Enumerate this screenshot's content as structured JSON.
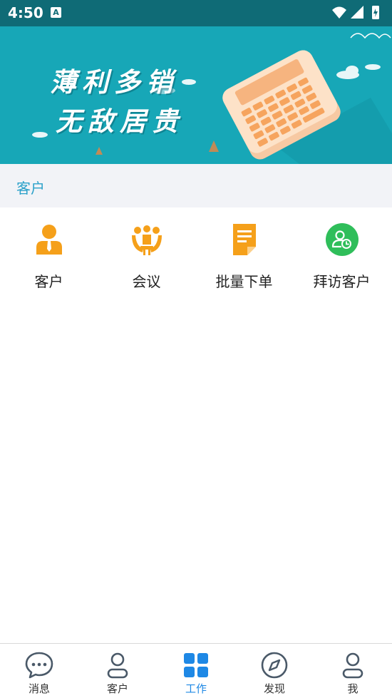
{
  "status_bar": {
    "time": "4:50",
    "notification_badge": "A"
  },
  "banner": {
    "line1": "薄利多销",
    "line2": "无敌居贵"
  },
  "section": {
    "title": "客户"
  },
  "grid": {
    "items": [
      {
        "label": "客户",
        "icon": "customer-icon"
      },
      {
        "label": "会议",
        "icon": "meeting-icon"
      },
      {
        "label": "批量下单",
        "icon": "batch-order-icon"
      },
      {
        "label": "拜访客户",
        "icon": "visit-customer-icon"
      }
    ]
  },
  "tabbar": {
    "items": [
      {
        "label": "消息",
        "icon": "message-icon"
      },
      {
        "label": "客户",
        "icon": "person-icon"
      },
      {
        "label": "工作",
        "icon": "grid-apps-icon",
        "active": true
      },
      {
        "label": "发现",
        "icon": "compass-icon"
      },
      {
        "label": "我",
        "icon": "profile-icon"
      }
    ]
  },
  "colors": {
    "status_bar": "#0f6b76",
    "banner": "#17a7b7",
    "accent": "#1e88e5",
    "section_title": "#2aa0c9",
    "orange_icon": "#f5a01a",
    "green_icon": "#2fbe5a"
  }
}
